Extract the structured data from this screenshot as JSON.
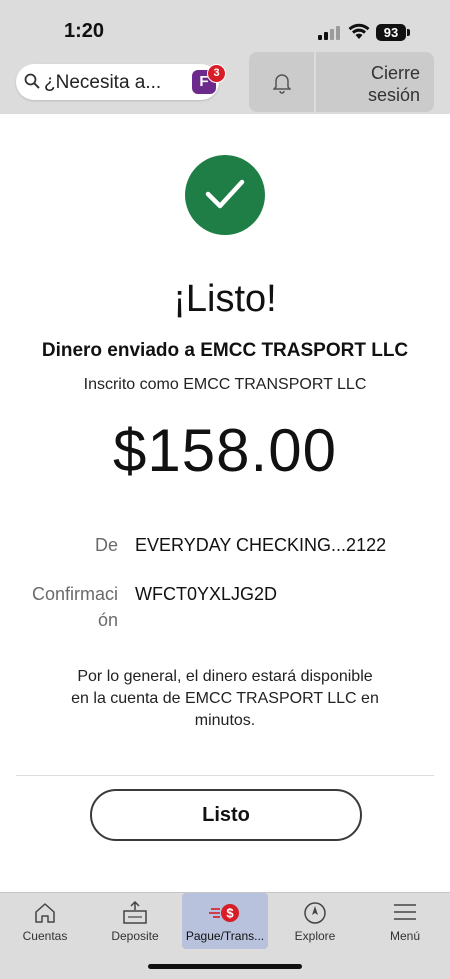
{
  "status_bar": {
    "time": "1:20",
    "battery": "93"
  },
  "header": {
    "search_placeholder": "¿Necesita a...",
    "fargo_badge": "F",
    "fargo_count": "3",
    "logout_line1": "Cierre",
    "logout_line2": "sesión"
  },
  "confirmation": {
    "heading": "¡Listo!",
    "sent_to": "Dinero enviado a EMCC TRASPORT LLC",
    "enrolled_as": "Inscrito como EMCC TRANSPORT LLC",
    "amount": "$158.00",
    "from_label": "De",
    "from_value": "EVERYDAY CHECKING...2122",
    "confirmation_label_line1": "Confirmaci",
    "confirmation_label_line2": "ón",
    "confirmation_value": "WFCT0YXLJG2D",
    "note_line1": "Por lo general, el dinero estará disponible",
    "note_line2": "en la cuenta de EMCC TRASPORT LLC en",
    "note_line3": "minutos.",
    "done_button": "Listo"
  },
  "tabbar": {
    "items": [
      {
        "label": "Cuentas",
        "icon": "home-icon"
      },
      {
        "label": "Deposite",
        "icon": "deposit-icon"
      },
      {
        "label": "Pague/Trans...",
        "icon": "pay-transfer-icon",
        "active": true
      },
      {
        "label": "Explore",
        "icon": "compass-icon"
      },
      {
        "label": "Menú",
        "icon": "menu-icon"
      }
    ]
  },
  "colors": {
    "success_green": "#1e7e45",
    "badge_red": "#d71e28",
    "fargo_purple": "#6c2a8c",
    "active_tab": "#b8c2dc"
  }
}
